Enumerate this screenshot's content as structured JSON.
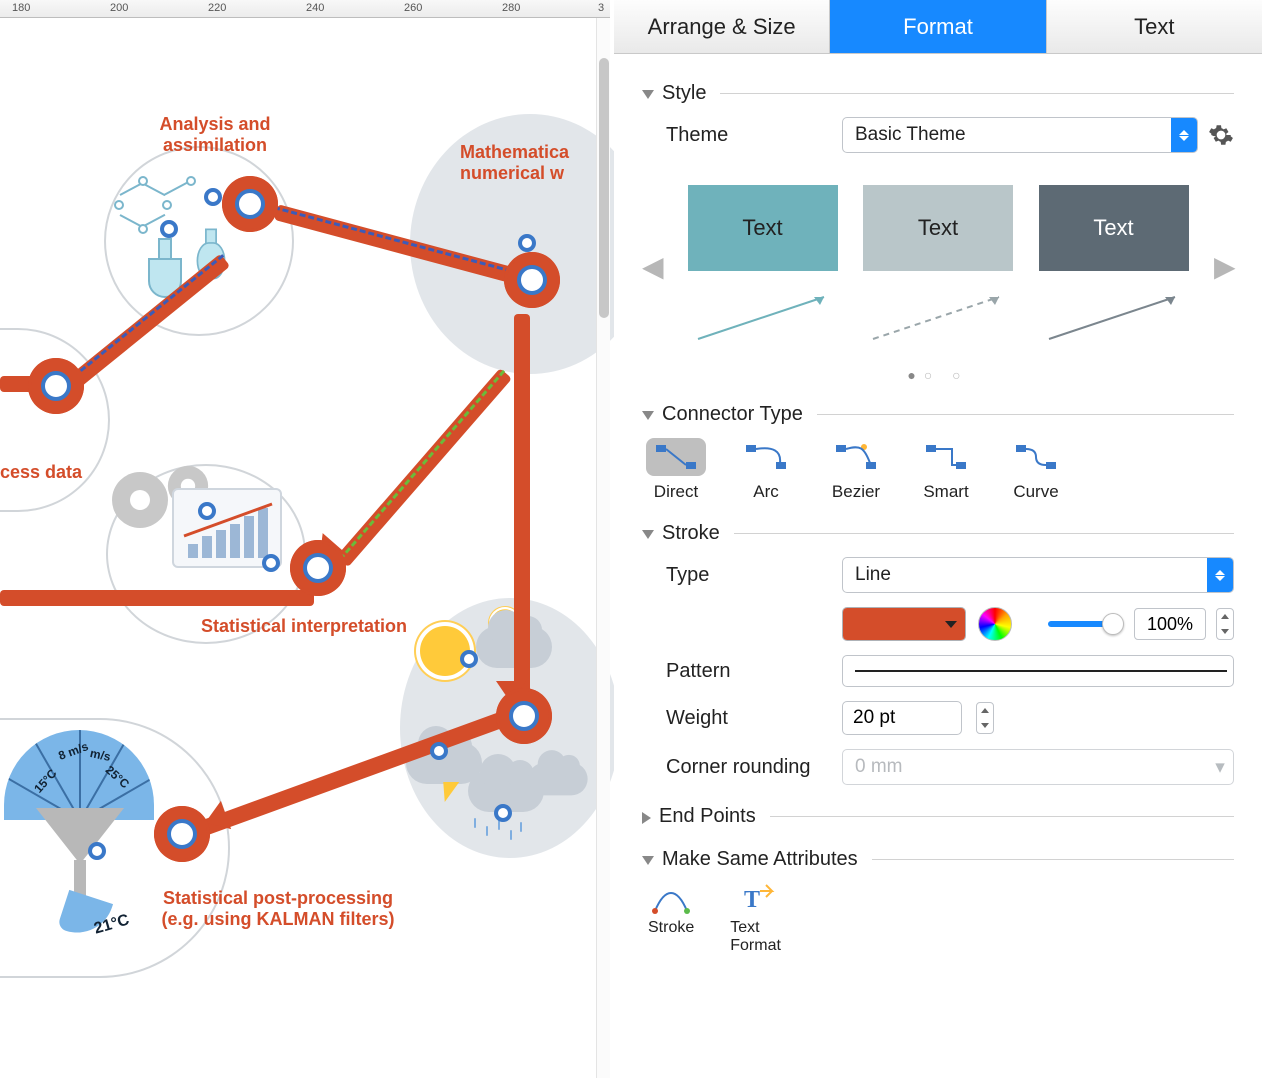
{
  "ruler": {
    "ticks": [
      "180",
      "200",
      "220",
      "240",
      "260",
      "280",
      "3"
    ]
  },
  "canvas": {
    "nodes": {
      "analysis": {
        "title_l1": "Analysis and",
        "title_l2": "assimilation"
      },
      "math": {
        "title_l1": "Mathematica",
        "title_l2": "numerical w"
      },
      "process": {
        "title": "cess data"
      },
      "stat_interp": {
        "title": "Statistical interpretation"
      },
      "stat_post": {
        "title_l1": "Statistical post-processing",
        "title_l2": "(e.g. using KALMAN filters)"
      }
    },
    "fan_labels": {
      "a": "8 m/s",
      "b": "m/s",
      "c": "15°C",
      "d": "25°C"
    },
    "temp_out": "21°C"
  },
  "inspector": {
    "tabs": {
      "arrange": "Arrange & Size",
      "format": "Format",
      "text": "Text"
    },
    "style": {
      "header": "Style",
      "theme_label": "Theme",
      "theme_value": "Basic Theme",
      "preview_text": "Text"
    },
    "connector": {
      "header": "Connector Type",
      "items": [
        "Direct",
        "Arc",
        "Bezier",
        "Smart",
        "Curve"
      ],
      "selected": "Direct"
    },
    "stroke": {
      "header": "Stroke",
      "type_label": "Type",
      "type_value": "Line",
      "opacity": "100%",
      "pattern_label": "Pattern",
      "weight_label": "Weight",
      "weight_value": "20 pt",
      "corner_label": "Corner rounding",
      "corner_placeholder": "0 mm",
      "color": "#d44d2a"
    },
    "endpoints": {
      "header": "End Points"
    },
    "make_same": {
      "header": "Make Same Attributes",
      "items": {
        "stroke": "Stroke",
        "textfmt_l1": "Text",
        "textfmt_l2": "Format"
      }
    }
  }
}
